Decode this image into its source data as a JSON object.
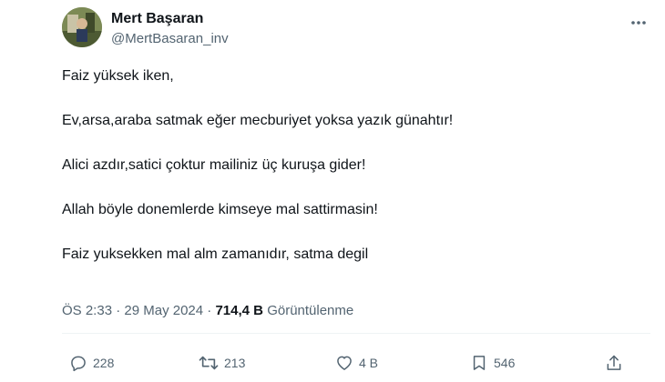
{
  "tweet": {
    "author": {
      "display_name": "Mert Başaran",
      "handle": "@MertBasaran_inv",
      "avatar_icon": "avatar-photo"
    },
    "lines": [
      "Faiz yüksek iken,",
      "Ev,arsa,araba satmak eğer mecburiyet yoksa yazık günahtır!",
      "Alici azdır,satici çoktur mailiniz üç kuruşa gider!",
      "Allah böyle donemlerde kimseye mal sattirmasin!",
      "Faiz yuksekken mal alm zamanıdır, satma degil"
    ],
    "meta": {
      "time": "ÖS 2:33",
      "separator": "·",
      "date": "29 May 2024",
      "views_count": "714,4 B",
      "views_label": "Görüntülenme"
    },
    "actions": {
      "replies": "228",
      "retweets": "213",
      "likes": "4 B",
      "bookmarks": "546"
    }
  },
  "colors": {
    "text_primary": "#0f1419",
    "text_secondary": "#536471",
    "divider": "#eff3f4"
  }
}
